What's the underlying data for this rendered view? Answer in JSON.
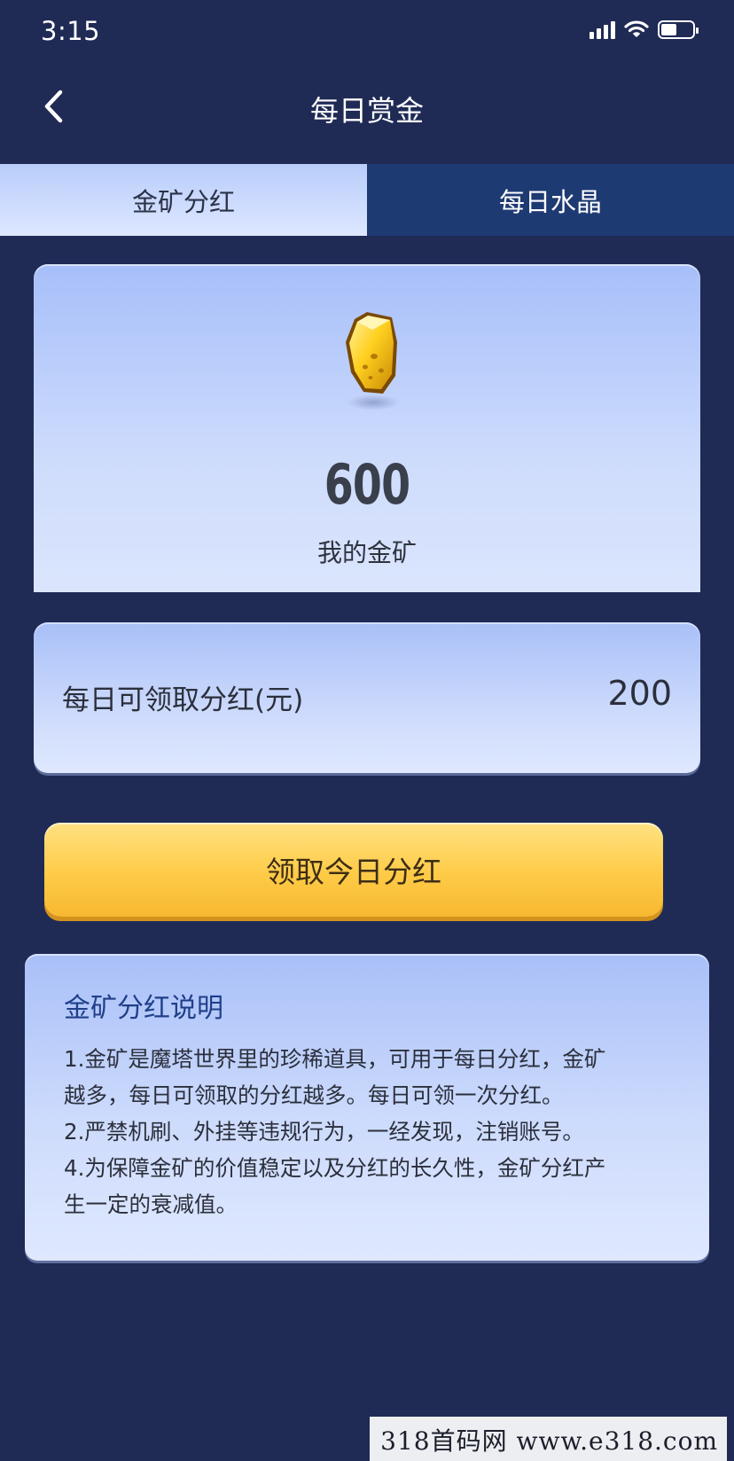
{
  "status_bar": {
    "time": "3:15",
    "battery_level": 0.5
  },
  "nav": {
    "title": "每日赏金",
    "back_icon": "chevron-left-icon"
  },
  "tabs": [
    {
      "label": "金矿分红",
      "active": true
    },
    {
      "label": "每日水晶",
      "active": false
    }
  ],
  "gold": {
    "icon": "gold-nugget-icon",
    "value": "600",
    "label": "我的金矿"
  },
  "dividend": {
    "label": "每日可领取分红(元)",
    "value": "200"
  },
  "claim_button": {
    "label": "领取今日分红"
  },
  "explanation": {
    "title": "金矿分红说明",
    "lines": [
      "1.金矿是魔塔世界里的珍稀道具，可用于每日分红，金矿",
      "越多，每日可领取的分红越多。每日可领一次分红。",
      "2.严禁机刷、外挂等违规行为，一经发现，注销账号。",
      "4.为保障金矿的价值稳定以及分红的长久性，金矿分红产",
      "生一定的衰减值。"
    ]
  },
  "watermark": "318首码网 www.e318.com",
  "colors": {
    "background": "#1f2b55",
    "tab_inactive": "#1e3a73",
    "button_gold": "#fecb47",
    "explain_title": "#1f3f8a"
  }
}
